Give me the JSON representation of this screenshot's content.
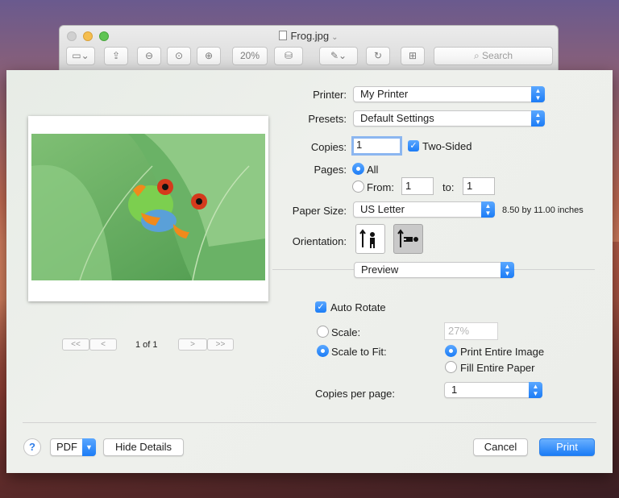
{
  "window": {
    "title": "Frog.jpg",
    "zoom": "20%",
    "search_placeholder": "Search"
  },
  "printer": {
    "label": "Printer:",
    "value": "My Printer"
  },
  "presets": {
    "label": "Presets:",
    "value": "Default Settings"
  },
  "copies": {
    "label": "Copies:",
    "value": "1",
    "two_sided_label": "Two-Sided",
    "two_sided_checked": true
  },
  "pages": {
    "label": "Pages:",
    "all_label": "All",
    "from_label": "From:",
    "from_value": "1",
    "to_label": "to:",
    "to_value": "1"
  },
  "paper_size": {
    "label": "Paper Size:",
    "value": "US Letter",
    "dimensions": "8.50 by 11.00 inches"
  },
  "orientation": {
    "label": "Orientation:",
    "selected": "landscape"
  },
  "section_popup": {
    "value": "Preview"
  },
  "auto_rotate": {
    "label": "Auto Rotate",
    "checked": true
  },
  "scale": {
    "label": "Scale:",
    "value": "27%"
  },
  "scale_to_fit": {
    "label": "Scale to Fit:",
    "print_entire_image": "Print Entire Image",
    "fill_entire_paper": "Fill Entire Paper"
  },
  "copies_per_page": {
    "label": "Copies per page:",
    "value": "1"
  },
  "pager": {
    "first": "<<",
    "prev": "<",
    "next": ">",
    "last": ">>",
    "count": "1 of 1"
  },
  "footer": {
    "help": "?",
    "pdf": "PDF",
    "hide_details": "Hide Details",
    "cancel": "Cancel",
    "print": "Print"
  },
  "colors": {
    "accent": "#1c7cf6",
    "leaf": "#5aa55a"
  }
}
